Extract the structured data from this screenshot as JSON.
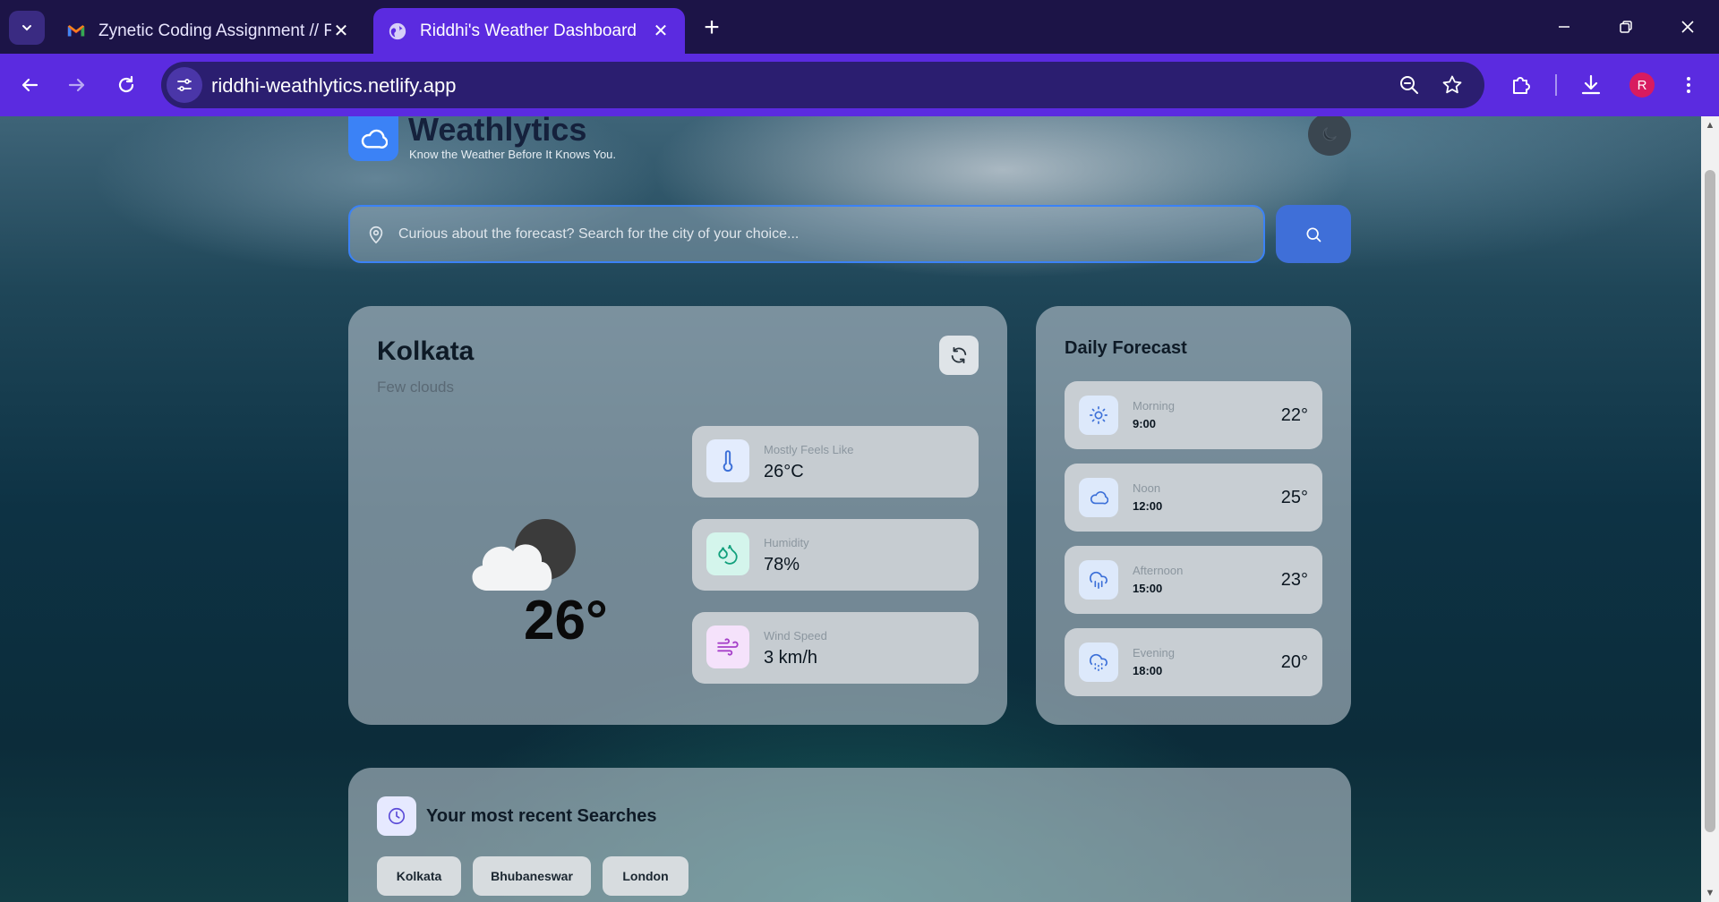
{
  "browser": {
    "tabs": [
      {
        "title": "Zynetic Coding Assignment // F",
        "active": false,
        "favicon": "gmail-icon"
      },
      {
        "title": "Riddhi's Weather Dashboard",
        "active": true,
        "favicon": "globe-icon"
      }
    ],
    "url": "riddhi-weathlytics.netlify.app",
    "profile_initial": "R",
    "accent_color": "#5b2be0"
  },
  "header": {
    "brand": "Weathlytics",
    "tagline": "Know the Weather Before It Knows You."
  },
  "search": {
    "placeholder": "Curious about the forecast? Search for the city of your choice..."
  },
  "current": {
    "city": "Kolkata",
    "description": "Few clouds",
    "temperature": "26°",
    "stats": [
      {
        "label": "Mostly Feels Like",
        "value": "26°C",
        "icon": "thermometer-icon",
        "color": "#e3ecfd"
      },
      {
        "label": "Humidity",
        "value": "78%",
        "icon": "droplets-icon",
        "color": "#d4f5ec"
      },
      {
        "label": "Wind Speed",
        "value": "3 km/h",
        "icon": "wind-icon",
        "color": "#f5e2fb"
      }
    ]
  },
  "forecast": {
    "title": "Daily Forecast",
    "items": [
      {
        "label": "Morning",
        "time": "9:00",
        "temp": "22°",
        "icon": "sun-icon"
      },
      {
        "label": "Noon",
        "time": "12:00",
        "temp": "25°",
        "icon": "cloud-icon"
      },
      {
        "label": "Afternoon",
        "time": "15:00",
        "temp": "23°",
        "icon": "cloud-rain-icon"
      },
      {
        "label": "Evening",
        "time": "18:00",
        "temp": "20°",
        "icon": "cloud-drizzle-icon"
      }
    ]
  },
  "recent": {
    "title": "Your most recent Searches",
    "items": [
      "Kolkata",
      "Bhubaneswar",
      "London"
    ]
  }
}
